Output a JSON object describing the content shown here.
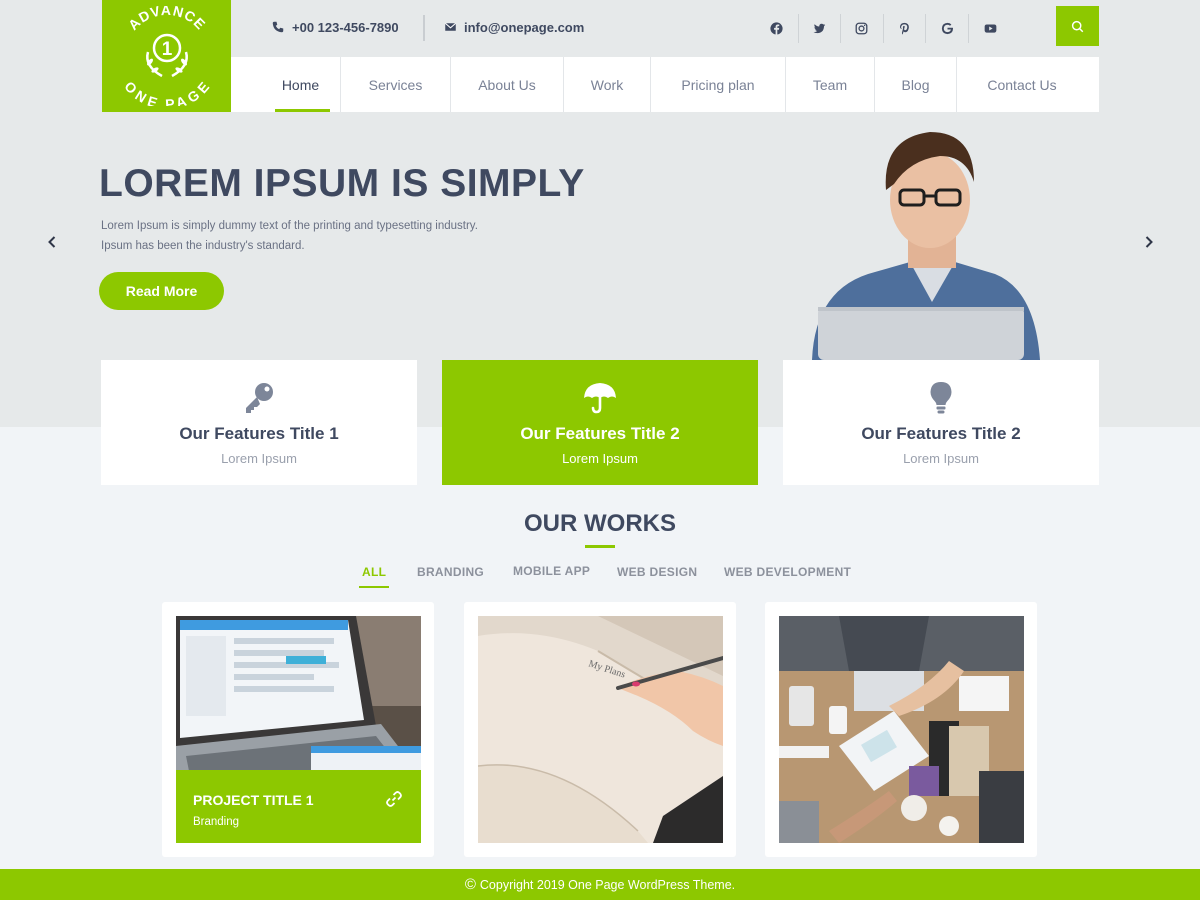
{
  "brand": {
    "logo_top": "ADVANCE",
    "logo_number": "1",
    "logo_bottom": "ONE PAGE",
    "accent_color": "#8dc800",
    "text_color": "#3f4960"
  },
  "topbar": {
    "phone": "+00 123-456-7890",
    "email": "info@onepage.com",
    "social_icons": [
      "facebook-icon",
      "twitter-icon",
      "instagram-icon",
      "pinterest-icon",
      "google-icon",
      "youtube-icon"
    ]
  },
  "nav": {
    "items": [
      {
        "label": "Home"
      },
      {
        "label": "Services"
      },
      {
        "label": "About Us"
      },
      {
        "label": "Work"
      },
      {
        "label": "Pricing plan"
      },
      {
        "label": "Team"
      },
      {
        "label": "Blog"
      },
      {
        "label": "Contact Us"
      }
    ],
    "active": "Home"
  },
  "hero": {
    "title": "LOREM IPSUM IS SIMPLY",
    "line1": "Lorem Ipsum is simply dummy text of the printing and typesetting industry.",
    "line2": "Ipsum has been the industry's standard.",
    "button": "Read More"
  },
  "features": [
    {
      "title": "Our Features Title 1",
      "subtitle": "Lorem Ipsum",
      "icon": "key-icon"
    },
    {
      "title": "Our Features Title 2",
      "subtitle": "Lorem Ipsum",
      "icon": "umbrella-icon"
    },
    {
      "title": "Our Features Title 2",
      "subtitle": "Lorem Ipsum",
      "icon": "lightbulb-icon"
    }
  ],
  "works": {
    "title": "OUR WORKS",
    "filters": [
      "ALL",
      "BRANDING",
      "MOBILE APP",
      "WEB DESIGN",
      "WEB DEVELOPMENT"
    ],
    "active_filter": "ALL",
    "projects": [
      {
        "title": "PROJECT TITLE 1",
        "category": "Branding"
      }
    ]
  },
  "footer": {
    "copyright_symbol": "©",
    "text": "Copyright 2019 One Page WordPress Theme."
  }
}
